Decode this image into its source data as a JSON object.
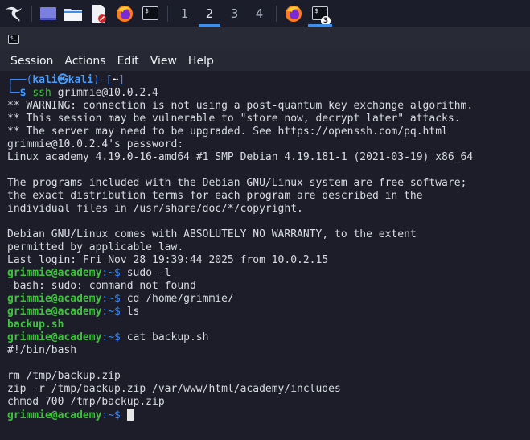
{
  "taskbar": {
    "workspaces": [
      "1",
      "2",
      "3",
      "4"
    ],
    "active_workspace": "2",
    "terminal_badge": "3",
    "icons": [
      "kali-dragon-icon",
      "desktop-icon",
      "files-icon",
      "text-editor-icon",
      "firefox-icon",
      "terminal-icon"
    ],
    "accent_color": "#3f8ee8"
  },
  "menu": [
    "Session",
    "Actions",
    "Edit",
    "View",
    "Help"
  ],
  "terminal": {
    "prompt_user": "kali",
    "prompt_at": "㉿",
    "prompt_host": "kali",
    "prompt_path": "~",
    "ssh_cmd": "ssh",
    "ssh_arg": "grimmie@10.0.2.4",
    "remote_user_host": "grimmie@academy",
    "remote_path_sep": ":~$",
    "lines": [
      "** WARNING: connection is not using a post-quantum key exchange algorithm.",
      "** This session may be vulnerable to \"store now, decrypt later\" attacks.",
      "** The server may need to be upgraded. See https://openssh.com/pq.html",
      "grimmie@10.0.2.4's password:",
      "Linux academy 4.19.0-16-amd64 #1 SMP Debian 4.19.181-1 (2021-03-19) x86_64",
      "",
      "The programs included with the Debian GNU/Linux system are free software;",
      "the exact distribution terms for each program are described in the",
      "individual files in /usr/share/doc/*/copyright.",
      "",
      "Debian GNU/Linux comes with ABSOLUTELY NO WARRANTY, to the extent",
      "permitted by applicable law.",
      "Last login: Fri Nov 28 19:39:44 2025 from 10.0.2.15"
    ],
    "cmd1": " sudo -l",
    "out1": "-bash: sudo: command not found",
    "cmd2": " cd /home/grimmie/",
    "cmd3": " ls",
    "ls_out": "backup.sh",
    "cmd4": " cat backup.sh",
    "script_lines": [
      "#!/bin/bash",
      "",
      "rm /tmp/backup.zip",
      "zip -r /tmp/backup.zip /var/www/html/academy/includes",
      "chmod 700 /tmp/backup.zip"
    ]
  }
}
